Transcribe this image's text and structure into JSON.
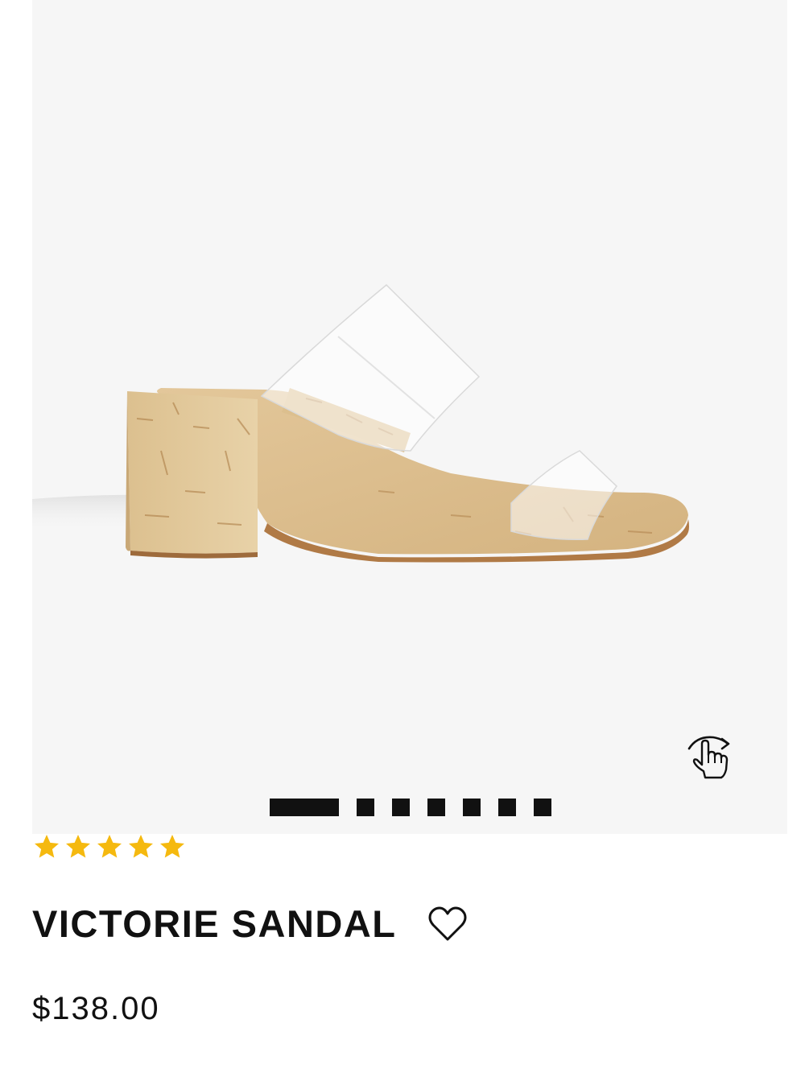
{
  "product": {
    "name": "VICTORIE SANDAL",
    "price": "$138.00",
    "rating": 5,
    "rating_max": 5,
    "image_alt": "Victorie Sandal product image"
  },
  "gallery": {
    "total_images": 7,
    "active_index": 0
  },
  "icons": {
    "rotate": "rotate-360-hand-icon",
    "favorite": "heart-icon",
    "star": "star-icon"
  },
  "colors": {
    "star": "#f5b90f",
    "indicator": "#111111",
    "gallery_bg": "#f6f6f6",
    "text": "#111111"
  }
}
